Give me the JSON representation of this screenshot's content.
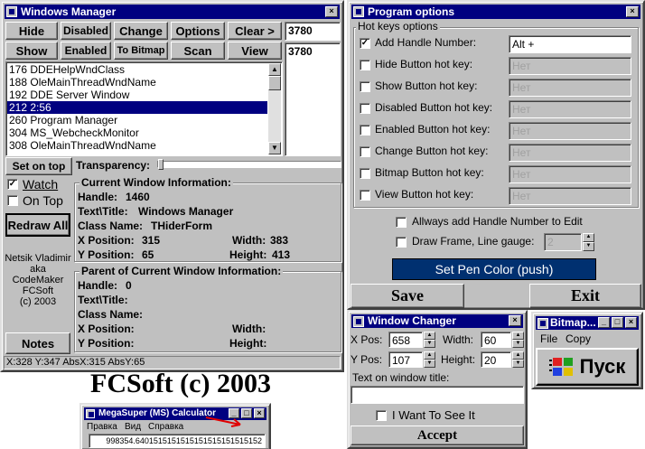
{
  "windows_manager": {
    "title": "Windows Manager",
    "buttons": {
      "hide": "Hide",
      "disabled": "Disabled",
      "change": "Change",
      "options": "Options",
      "clear": "Clear >",
      "show": "Show",
      "enabled": "Enabled",
      "to_bitmap": "To Bitmap",
      "scan": "Scan",
      "view": "View",
      "set_on_top": "Set on top",
      "redraw_all": "Redraw All",
      "notes": "Notes"
    },
    "handle_field_1": "3780",
    "handle_field_2": "3780",
    "list": [
      "176 DDEHelpWndClass",
      "188 OleMainThreadWndName",
      "192 DDE Server Window",
      "212 2:56",
      "260 Program Manager",
      "304 MS_WebcheckMonitor",
      "308 OleMainThreadWndName"
    ],
    "selected_index": 3,
    "transparency_label": "Transparency:",
    "watch_label": "Watch",
    "on_top_label": "On Top",
    "credits": [
      "Netsik Vladimir",
      "aka",
      "CodeMaker",
      "FCSoft",
      "(c) 2003"
    ],
    "current": {
      "title": "Current Window Information:",
      "handle_label": "Handle:",
      "handle_value": "1460",
      "text_label": "Text\\Title:",
      "text_value": "Windows Manager",
      "class_label": "Class Name:",
      "class_value": "THiderForm",
      "xpos_label": "X Position:",
      "xpos_value": "315",
      "ypos_label": "Y Position:",
      "ypos_value": "65",
      "width_label": "Width:",
      "width_value": "383",
      "height_label": "Height:",
      "height_value": "413"
    },
    "parent": {
      "title": "Parent of Current Window Information:",
      "handle_label": "Handle:",
      "handle_value": "0",
      "text_label": "Text\\Title:",
      "class_label": "Class Name:",
      "xpos_label": "X Position:",
      "ypos_label": "Y Position:",
      "width_label": "Width:",
      "height_label": "Height:"
    },
    "status": "X:328 Y:347 AbsX:315 AbsY:65"
  },
  "program_options": {
    "title": "Program options",
    "group_title": "Hot keys options",
    "rows": [
      {
        "label": "Add Handle Number:",
        "value": "Alt +",
        "checked": true
      },
      {
        "label": "Hide Button hot key:",
        "value": "Нет",
        "checked": false
      },
      {
        "label": "Show Button hot key:",
        "value": "Нет",
        "checked": false
      },
      {
        "label": "Disabled Button hot key:",
        "value": "Нет",
        "checked": false
      },
      {
        "label": "Enabled Button hot key:",
        "value": "Нет",
        "checked": false
      },
      {
        "label": "Change Button hot key:",
        "value": "Нет",
        "checked": false
      },
      {
        "label": "Bitmap Button hot key:",
        "value": "Нет",
        "checked": false
      },
      {
        "label": "View Button hot key:",
        "value": "Нет",
        "checked": false
      }
    ],
    "always_add_label": "Allways add Handle Number to Edit",
    "draw_frame_label": "Draw Frame, Line gauge:",
    "gauge_value": "2",
    "pen_color_button": "Set Pen Color (push)",
    "save_button": "Save",
    "exit_button": "Exit",
    "pen_color": "#003070"
  },
  "window_changer": {
    "title": "Window Changer",
    "xpos_label": "X Pos:",
    "xpos_value": "658",
    "ypos_label": "Y Pos:",
    "ypos_value": "107",
    "width_label": "Width:",
    "width_value": "60",
    "height_label": "Height:",
    "height_value": "20",
    "text_label": "Text on window title:",
    "text_value": "",
    "want_label": "I Want To See It",
    "accept_button": "Accept"
  },
  "bitmap_window": {
    "title": "Bitmap...",
    "menu_file": "File",
    "menu_copy": "Copy",
    "start_button": "Пуск"
  },
  "banner": "FCSoft (c) 2003",
  "calculator": {
    "title": "MegaSuper (MS) Calculator",
    "menu": [
      "Правка",
      "Вид",
      "Справка"
    ],
    "display": "998354.6401515151515151515151515152"
  }
}
